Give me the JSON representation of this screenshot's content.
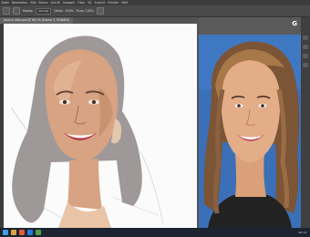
{
  "menubar": {
    "items": [
      "Datei",
      "Bearbeiten",
      "Bild",
      "Ebene",
      "Schrift",
      "Auswahl",
      "Filter",
      "3D",
      "Ansicht",
      "Fenster",
      "Hilfe"
    ]
  },
  "options": {
    "field1": "Modus: ",
    "dd1": "Normal",
    "field2": "Deckr.: 100%",
    "field3": "Fluss: 100%"
  },
  "document": {
    "tab_label": "Jessica Alba.psd @ 66,7% (Ebene 3, RGB/8#)"
  },
  "photo_panel": {
    "icon_label": "G"
  },
  "taskbar": {
    "clock": "20:14"
  },
  "colors": {
    "hair_fill": "#9f9898",
    "skin": "#d7a383",
    "panel_bg": "#535353",
    "canvas_bg": "#fbfbfb"
  }
}
